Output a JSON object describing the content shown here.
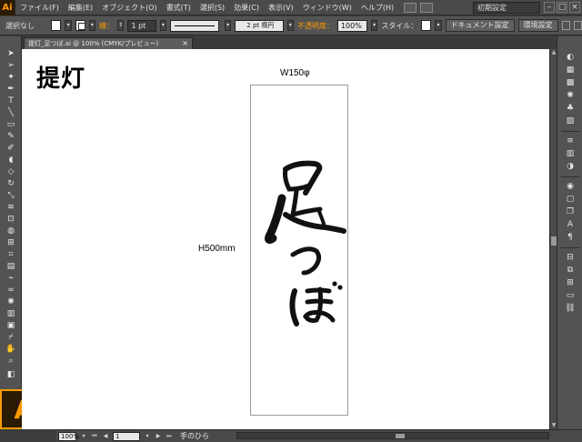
{
  "app": {
    "logo": "Ai",
    "menu": [
      "ファイル(F)",
      "編集(E)",
      "オブジェクト(O)",
      "書式(T)",
      "選択(S)",
      "効果(C)",
      "表示(V)",
      "ウィンドウ(W)",
      "ヘルプ(H)"
    ],
    "workspace": "初期設定",
    "window_buttons": [
      "–",
      "□",
      "×"
    ]
  },
  "control_bar": {
    "selection_status": "選択なし",
    "stroke_label": "線：",
    "stroke_weight": "1 pt",
    "profile": "均等",
    "brush": "2 pt 楕円",
    "opacity_label": "不透明度：",
    "opacity_value": "100%",
    "style_label": "スタイル：",
    "doc_setup_button": "ドキュメント設定",
    "preferences_button": "環境設定"
  },
  "document": {
    "tab_title": "提灯_足つぼ.ai @ 100% (CMYK/プレビュー)",
    "heading": "提灯",
    "width_label": "W150φ",
    "height_label": "H500mm",
    "calligraphy_text": "足つぼ"
  },
  "status_bar": {
    "zoom": "100%",
    "page": "1",
    "current_tool": "手のひら"
  },
  "colors": {
    "accent": "#ff9a00",
    "ui_dark": "#535353",
    "canvas": "#ffffff"
  }
}
